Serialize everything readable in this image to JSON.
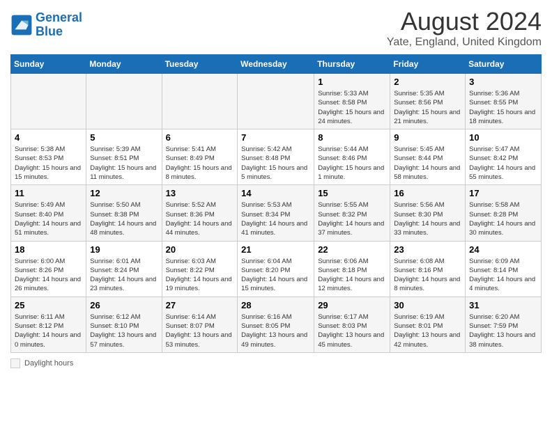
{
  "header": {
    "logo_line1": "General",
    "logo_line2": "Blue",
    "month": "August 2024",
    "location": "Yate, England, United Kingdom"
  },
  "days_of_week": [
    "Sunday",
    "Monday",
    "Tuesday",
    "Wednesday",
    "Thursday",
    "Friday",
    "Saturday"
  ],
  "weeks": [
    [
      {
        "day": "",
        "info": ""
      },
      {
        "day": "",
        "info": ""
      },
      {
        "day": "",
        "info": ""
      },
      {
        "day": "",
        "info": ""
      },
      {
        "day": "1",
        "info": "Sunrise: 5:33 AM\nSunset: 8:58 PM\nDaylight: 15 hours and 24 minutes."
      },
      {
        "day": "2",
        "info": "Sunrise: 5:35 AM\nSunset: 8:56 PM\nDaylight: 15 hours and 21 minutes."
      },
      {
        "day": "3",
        "info": "Sunrise: 5:36 AM\nSunset: 8:55 PM\nDaylight: 15 hours and 18 minutes."
      }
    ],
    [
      {
        "day": "4",
        "info": "Sunrise: 5:38 AM\nSunset: 8:53 PM\nDaylight: 15 hours and 15 minutes."
      },
      {
        "day": "5",
        "info": "Sunrise: 5:39 AM\nSunset: 8:51 PM\nDaylight: 15 hours and 11 minutes."
      },
      {
        "day": "6",
        "info": "Sunrise: 5:41 AM\nSunset: 8:49 PM\nDaylight: 15 hours and 8 minutes."
      },
      {
        "day": "7",
        "info": "Sunrise: 5:42 AM\nSunset: 8:48 PM\nDaylight: 15 hours and 5 minutes."
      },
      {
        "day": "8",
        "info": "Sunrise: 5:44 AM\nSunset: 8:46 PM\nDaylight: 15 hours and 1 minute."
      },
      {
        "day": "9",
        "info": "Sunrise: 5:45 AM\nSunset: 8:44 PM\nDaylight: 14 hours and 58 minutes."
      },
      {
        "day": "10",
        "info": "Sunrise: 5:47 AM\nSunset: 8:42 PM\nDaylight: 14 hours and 55 minutes."
      }
    ],
    [
      {
        "day": "11",
        "info": "Sunrise: 5:49 AM\nSunset: 8:40 PM\nDaylight: 14 hours and 51 minutes."
      },
      {
        "day": "12",
        "info": "Sunrise: 5:50 AM\nSunset: 8:38 PM\nDaylight: 14 hours and 48 minutes."
      },
      {
        "day": "13",
        "info": "Sunrise: 5:52 AM\nSunset: 8:36 PM\nDaylight: 14 hours and 44 minutes."
      },
      {
        "day": "14",
        "info": "Sunrise: 5:53 AM\nSunset: 8:34 PM\nDaylight: 14 hours and 41 minutes."
      },
      {
        "day": "15",
        "info": "Sunrise: 5:55 AM\nSunset: 8:32 PM\nDaylight: 14 hours and 37 minutes."
      },
      {
        "day": "16",
        "info": "Sunrise: 5:56 AM\nSunset: 8:30 PM\nDaylight: 14 hours and 33 minutes."
      },
      {
        "day": "17",
        "info": "Sunrise: 5:58 AM\nSunset: 8:28 PM\nDaylight: 14 hours and 30 minutes."
      }
    ],
    [
      {
        "day": "18",
        "info": "Sunrise: 6:00 AM\nSunset: 8:26 PM\nDaylight: 14 hours and 26 minutes."
      },
      {
        "day": "19",
        "info": "Sunrise: 6:01 AM\nSunset: 8:24 PM\nDaylight: 14 hours and 23 minutes."
      },
      {
        "day": "20",
        "info": "Sunrise: 6:03 AM\nSunset: 8:22 PM\nDaylight: 14 hours and 19 minutes."
      },
      {
        "day": "21",
        "info": "Sunrise: 6:04 AM\nSunset: 8:20 PM\nDaylight: 14 hours and 15 minutes."
      },
      {
        "day": "22",
        "info": "Sunrise: 6:06 AM\nSunset: 8:18 PM\nDaylight: 14 hours and 12 minutes."
      },
      {
        "day": "23",
        "info": "Sunrise: 6:08 AM\nSunset: 8:16 PM\nDaylight: 14 hours and 8 minutes."
      },
      {
        "day": "24",
        "info": "Sunrise: 6:09 AM\nSunset: 8:14 PM\nDaylight: 14 hours and 4 minutes."
      }
    ],
    [
      {
        "day": "25",
        "info": "Sunrise: 6:11 AM\nSunset: 8:12 PM\nDaylight: 14 hours and 0 minutes."
      },
      {
        "day": "26",
        "info": "Sunrise: 6:12 AM\nSunset: 8:10 PM\nDaylight: 13 hours and 57 minutes."
      },
      {
        "day": "27",
        "info": "Sunrise: 6:14 AM\nSunset: 8:07 PM\nDaylight: 13 hours and 53 minutes."
      },
      {
        "day": "28",
        "info": "Sunrise: 6:16 AM\nSunset: 8:05 PM\nDaylight: 13 hours and 49 minutes."
      },
      {
        "day": "29",
        "info": "Sunrise: 6:17 AM\nSunset: 8:03 PM\nDaylight: 13 hours and 45 minutes."
      },
      {
        "day": "30",
        "info": "Sunrise: 6:19 AM\nSunset: 8:01 PM\nDaylight: 13 hours and 42 minutes."
      },
      {
        "day": "31",
        "info": "Sunrise: 6:20 AM\nSunset: 7:59 PM\nDaylight: 13 hours and 38 minutes."
      }
    ]
  ],
  "legend": {
    "label": "Daylight hours"
  }
}
